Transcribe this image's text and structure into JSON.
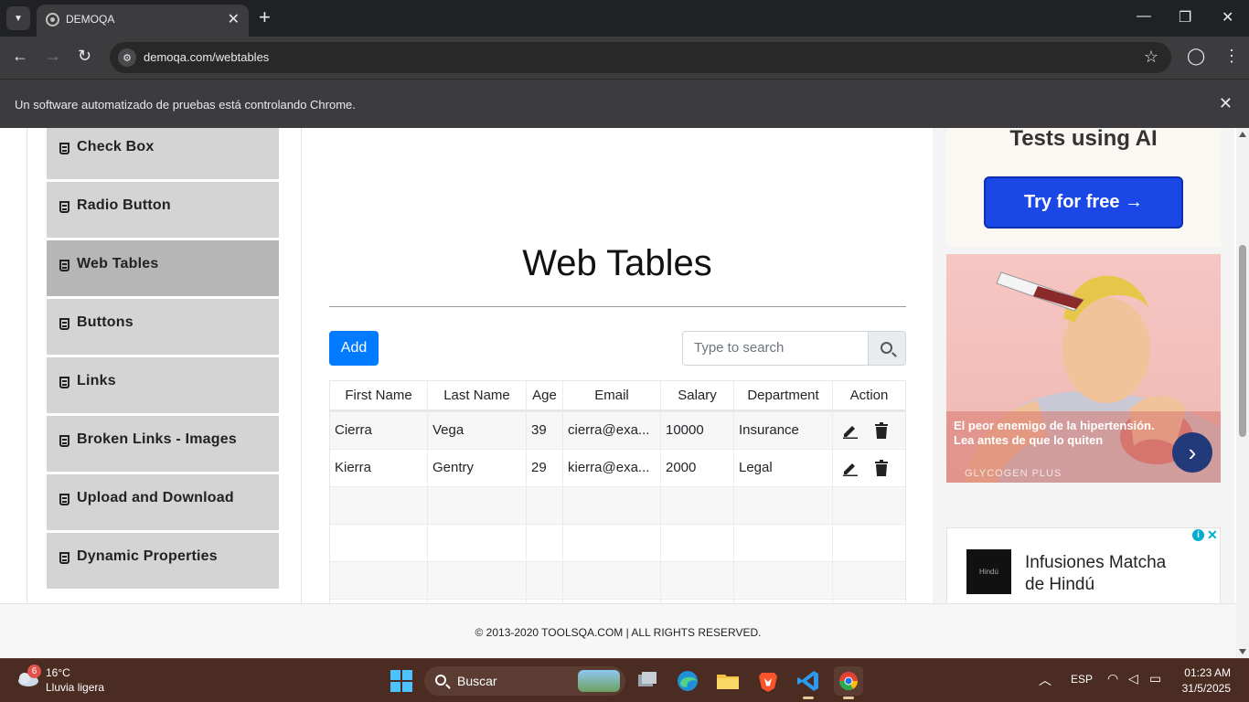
{
  "browser": {
    "tab_title": "DEMOQA",
    "url": "demoqa.com/webtables",
    "infobar_message": "Un software automatizado de pruebas está controlando Chrome."
  },
  "sidebar": {
    "items": [
      {
        "label": "Check Box",
        "active": false
      },
      {
        "label": "Radio Button",
        "active": false
      },
      {
        "label": "Web Tables",
        "active": true
      },
      {
        "label": "Buttons",
        "active": false
      },
      {
        "label": "Links",
        "active": false
      },
      {
        "label": "Broken Links - Images",
        "active": false
      },
      {
        "label": "Upload and Download",
        "active": false
      },
      {
        "label": "Dynamic Properties",
        "active": false
      }
    ]
  },
  "main": {
    "title": "Web Tables",
    "add_label": "Add",
    "search_placeholder": "Type to search",
    "table": {
      "columns": [
        "First Name",
        "Last Name",
        "Age",
        "Email",
        "Salary",
        "Department",
        "Action"
      ],
      "rows": [
        {
          "first": "Cierra",
          "last": "Vega",
          "age": "39",
          "email": "cierra@exa...",
          "salary": "10000",
          "department": "Insurance"
        },
        {
          "first": "Kierra",
          "last": "Gentry",
          "age": "29",
          "email": "kierra@exa...",
          "salary": "2000",
          "department": "Legal"
        }
      ]
    }
  },
  "ads": {
    "ad1_headline": "Tests using AI",
    "ad1_button": "Try for free →",
    "ad2_caption": "El peor enemigo de la hipertensión. Lea antes de que lo quiten",
    "ad2_brand": "GLYCOGEN PLUS",
    "ad3_text": "Infusiones Matcha de Hindú",
    "ad3_logo": "Hindú"
  },
  "footer": {
    "text": "© 2013-2020 TOOLSQA.COM | ALL RIGHTS RESERVED."
  },
  "taskbar": {
    "weather_badge": "6",
    "weather_temp": "16°C",
    "weather_desc": "Lluvia ligera",
    "search_label": "Buscar",
    "language": "ESP",
    "time": "01:23 AM",
    "date": "31/5/2025"
  },
  "colors": {
    "accent": "#007bff",
    "sidebar_active": "#b6b6b6",
    "sidebar_item": "#d4d4d4"
  }
}
